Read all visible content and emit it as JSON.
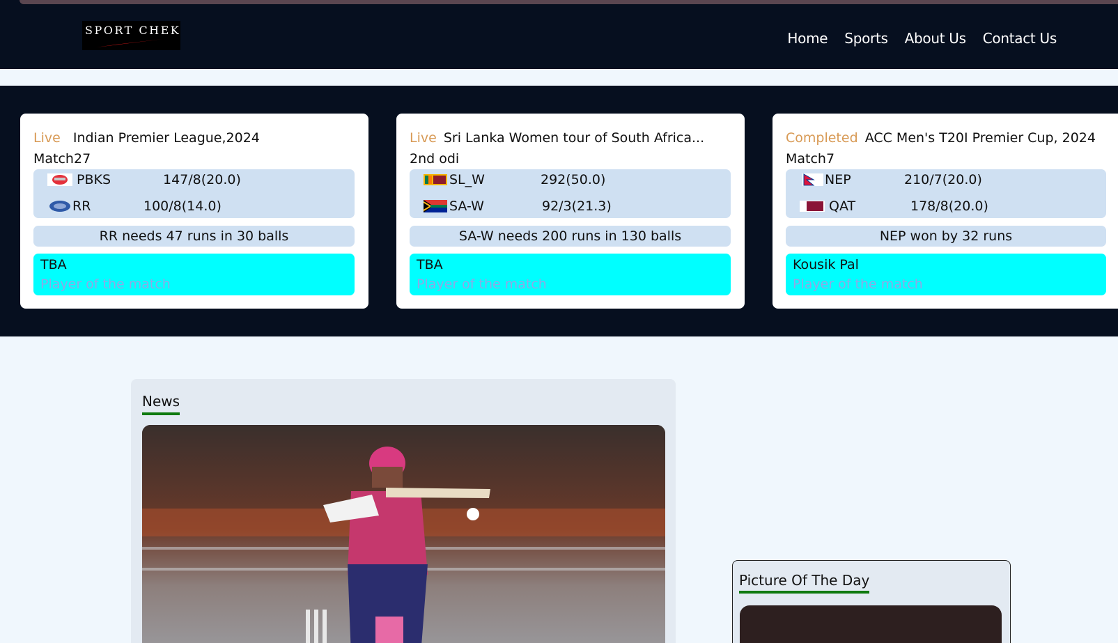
{
  "header": {
    "logo_text": "SPORT CHEK",
    "nav": [
      {
        "label": "Home"
      },
      {
        "label": "Sports"
      },
      {
        "label": "About Us"
      },
      {
        "label": "Contact Us"
      }
    ]
  },
  "matches": [
    {
      "status": "Live",
      "status_color": "#d89a55",
      "series": "Indian Premier League,2024",
      "match_no": "Match27",
      "teams": [
        {
          "abbr": "PBKS",
          "score": "147/8(20.0)",
          "flag_icon": "pbks-logo-icon"
        },
        {
          "abbr": "RR",
          "score": "100/8(14.0)",
          "flag_icon": "rr-logo-icon"
        }
      ],
      "result": "RR needs 47 runs in 30 balls",
      "player_of_match": "TBA",
      "player_label": "Player of the match"
    },
    {
      "status": "Live",
      "status_color": "#d89a55",
      "series": "Sri Lanka Women tour of South Africa...",
      "match_no": "2nd odi",
      "teams": [
        {
          "abbr": "SL_W",
          "score": "292(50.0)",
          "flag_icon": "sri-lanka-flag-icon"
        },
        {
          "abbr": "SA-W",
          "score": "92/3(21.3)",
          "flag_icon": "south-africa-flag-icon"
        }
      ],
      "result": "SA-W needs 200 runs in 130 balls",
      "player_of_match": "TBA",
      "player_label": "Player of the match"
    },
    {
      "status": "Completed",
      "status_color": "#d89a55",
      "series": "ACC Men's T20I Premier Cup, 2024",
      "match_no": "Match7",
      "teams": [
        {
          "abbr": "NEP",
          "score": "210/7(20.0)",
          "flag_icon": "nepal-flag-icon"
        },
        {
          "abbr": "QAT",
          "score": "178/8(20.0)",
          "flag_icon": "qatar-flag-icon"
        }
      ],
      "result": "NEP won by 32 runs",
      "player_of_match": "Kousik Pal",
      "player_label": "Player of the match"
    }
  ],
  "news": {
    "title": "News"
  },
  "picture_of_day": {
    "title": "Picture Of The Day"
  },
  "colors": {
    "navbar_bg": "#060f1f",
    "accent_green": "#0f7a0f",
    "potm_bg": "#00ffff",
    "status_orange": "#d89a55"
  }
}
